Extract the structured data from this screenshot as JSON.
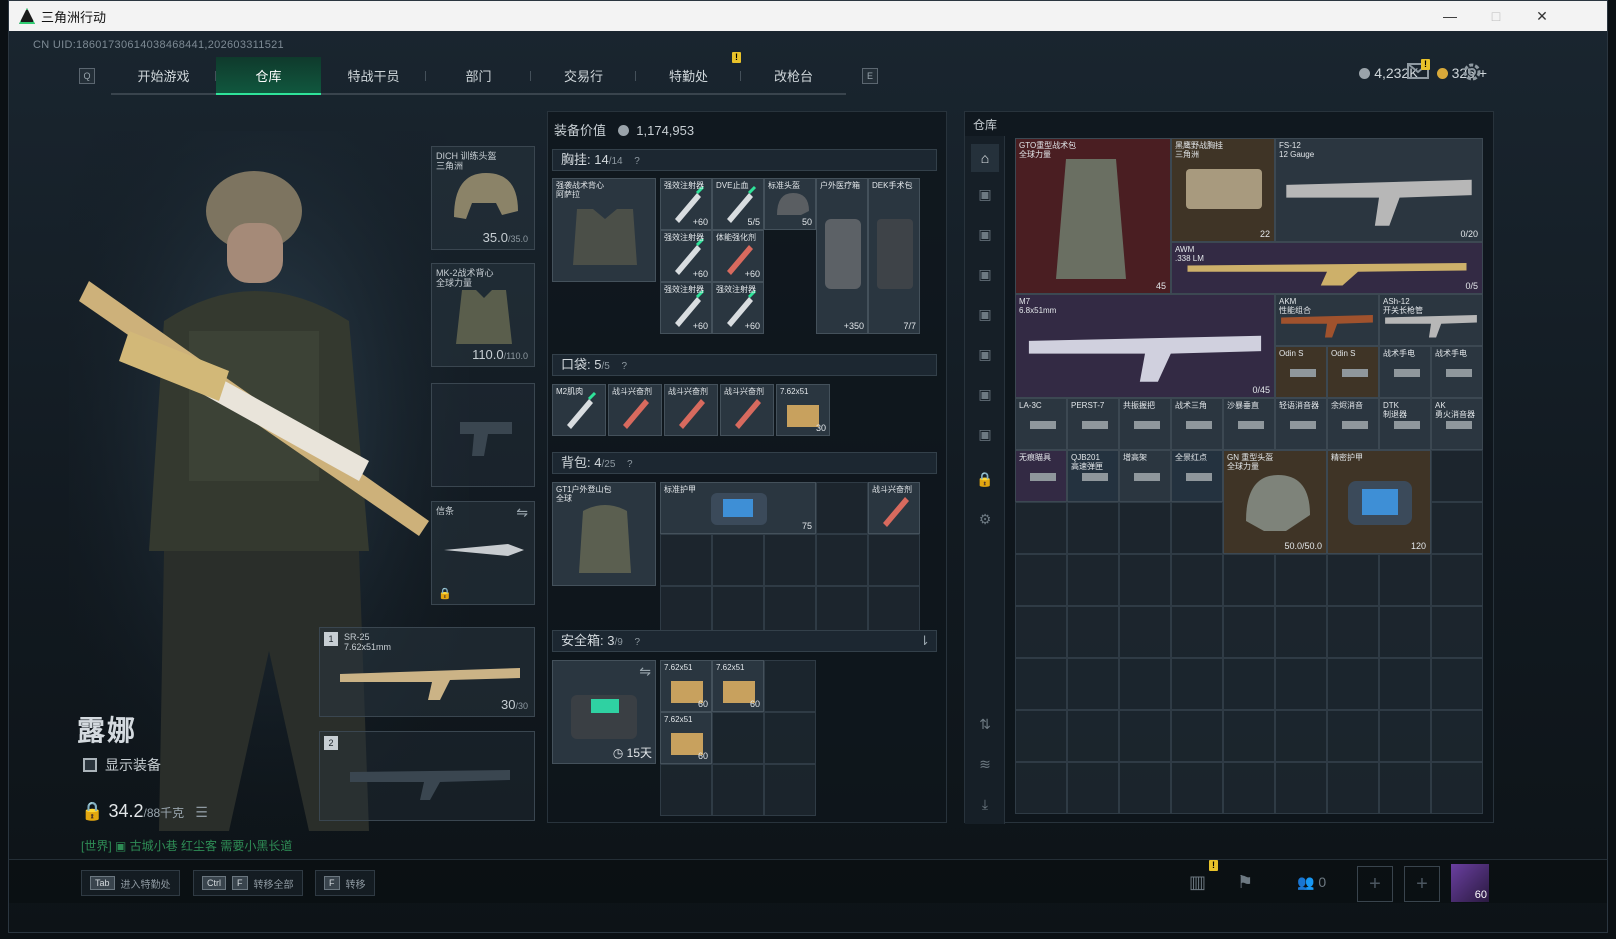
{
  "window": {
    "title": "三角洲行动",
    "minimize": "—",
    "maximize": "□",
    "close": "✕"
  },
  "uid": "CN UID:18601730614038468441,202603311521",
  "nav": {
    "key_left": "Q",
    "key_right": "E",
    "tabs": [
      "开始游戏",
      "仓库",
      "特战干员",
      "部门",
      "交易行",
      "特勤处",
      "改枪台"
    ],
    "alert": "!"
  },
  "currency": {
    "silver": "4,232K",
    "gold": "325",
    "plus": "+"
  },
  "mail_alert": "!",
  "character": {
    "name": "露娜",
    "show_equipment": "显示装备",
    "weight": "34.2",
    "weight_max": "/88千克",
    "chat": "[世界] ▣ 古城小巷 红尘客  需要小黑长道"
  },
  "slots": {
    "helmet": {
      "label": "DICH 训练头盔\n三角洲",
      "dur": "35.0",
      "max": "/35.0"
    },
    "armor": {
      "label": "MK-2战术背心\n全球力量",
      "dur": "110.0",
      "max": "/110.0"
    },
    "melee": {
      "label": "信条"
    },
    "primary1": {
      "idx": "1",
      "label": "SR-25\n7.62x51mm",
      "ammo": "30",
      "max": "/30"
    },
    "primary2": {
      "idx": "2"
    }
  },
  "middle": {
    "value_label": "装备价值",
    "value": "1,174,953",
    "chest": {
      "title": "胸挂:",
      "count": "14",
      "max": "/14",
      "help": "?"
    },
    "pocket": {
      "title": "口袋:",
      "count": "5",
      "max": "/5",
      "help": "?"
    },
    "backpack": {
      "title": "背包:",
      "count": "4",
      "max": "/25",
      "help": "?"
    },
    "safe": {
      "title": "安全箱:",
      "count": "3",
      "max": "/9",
      "help": "?"
    },
    "chest_rig": {
      "name": "强袭战术背心\n阿萨拉"
    },
    "chest_items": [
      {
        "name": "强效注射器",
        "val": "+60"
      },
      {
        "name": "DVE止血",
        "val": "5/5"
      },
      {
        "name": "标准头盔",
        "val": "50"
      },
      {
        "name": "户外医疗箱",
        "val": "+350"
      },
      {
        "name": "DEK手术包",
        "val": "7/7"
      },
      {
        "name": "强效注射器",
        "val": "+60"
      },
      {
        "name": "体能强化剂",
        "val": "+60"
      },
      {
        "name": "强效注射器",
        "val": "+60"
      },
      {
        "name": "强效注射器",
        "val": "+60"
      }
    ],
    "pocket_items": [
      {
        "name": "M2肌肉",
        "val": ""
      },
      {
        "name": "战斗兴奋剂",
        "val": ""
      },
      {
        "name": "战斗兴奋剂",
        "val": ""
      },
      {
        "name": "战斗兴奋剂",
        "val": ""
      },
      {
        "name": "7.62x51",
        "val": "30"
      }
    ],
    "backpack_name": "GT1户外登山包\n全球",
    "backpack_items": [
      {
        "name": "标准护甲",
        "val": "75"
      },
      {
        "name": "战斗兴奋剂",
        "val": ""
      }
    ],
    "safe_timer": "15天",
    "safe_items": [
      {
        "name": "7.62x51",
        "val": "60"
      },
      {
        "name": "7.62x51",
        "val": "60"
      },
      {
        "name": "7.62x51",
        "val": "60"
      }
    ]
  },
  "stash": {
    "title": "仓库",
    "items": [
      {
        "name": "GTO重型战术包\n全球力量",
        "val": "45"
      },
      {
        "name": "黑鹰野战胸挂\n三角洲",
        "val": "22"
      },
      {
        "name": "FS-12\n12 Gauge",
        "val": "0/20"
      },
      {
        "name": "AWM\n.338 LM",
        "val": "0/5"
      },
      {
        "name": "M7\n6.8x51mm",
        "val": "0/45"
      },
      {
        "name": "AKM\n性能组合",
        "val": ""
      },
      {
        "name": "ASh-12\n开关长枪管",
        "val": ""
      },
      {
        "name": "Odin S",
        "val": ""
      },
      {
        "name": "Odin S",
        "val": ""
      },
      {
        "name": "战术手电",
        "val": ""
      },
      {
        "name": "战术手电",
        "val": ""
      },
      {
        "name": "LA-3C",
        "val": ""
      },
      {
        "name": "PERST-7",
        "val": ""
      },
      {
        "name": "共振握把",
        "val": ""
      },
      {
        "name": "战术三角",
        "val": ""
      },
      {
        "name": "沙暴垂直",
        "val": ""
      },
      {
        "name": "轻语消音器",
        "val": ""
      },
      {
        "name": "余烬消音",
        "val": ""
      },
      {
        "name": "DTK\n制退器",
        "val": ""
      },
      {
        "name": "AK\n勇火消音器",
        "val": ""
      },
      {
        "name": "无痕瞄具",
        "val": ""
      },
      {
        "name": "QJB201\n高速弹匣",
        "val": ""
      },
      {
        "name": "增高架",
        "val": ""
      },
      {
        "name": "全景红点",
        "val": ""
      },
      {
        "name": "GN 重型头盔\n全球力量",
        "val": "50.0/50.0"
      },
      {
        "name": "精密护甲",
        "val": "120"
      }
    ]
  },
  "bottom": {
    "hints": [
      {
        "key": "Tab",
        "key2": "",
        "label": "进入特勤处"
      },
      {
        "key": "Ctrl",
        "key2": "F",
        "label": "转移全部"
      },
      {
        "key": "F",
        "key2": "",
        "label": "转移"
      }
    ],
    "friends": "0",
    "avatar_level": "60",
    "alert": "!"
  },
  "colors": {
    "accent": "#2fe39a",
    "tab_active": "#10573e",
    "alert": "#e8c22a"
  }
}
